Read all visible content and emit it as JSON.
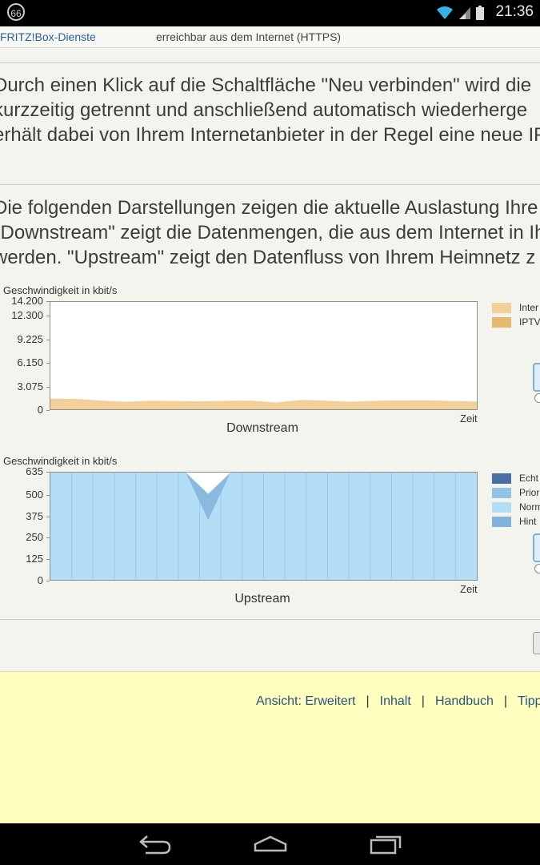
{
  "statusbar": {
    "badge": "66",
    "time": "21:36"
  },
  "toprow": {
    "service": "FRITZ!Box-Dienste",
    "access": "erreichbar aus dem Internet (HTTPS)"
  },
  "paragraph1": [
    "Durch einen Klick auf die Schaltfläche \"Neu verbinden\" wird die",
    "kurzzeitig getrennt und anschließend automatisch wiederherge",
    "erhält dabei von Ihrem Internetanbieter in der Regel eine neue IP"
  ],
  "paragraph2": [
    "Die folgenden Darstellungen zeigen die aktuelle Auslastung Ihre",
    "\"Downstream\" zeigt die Datenmengen, die aus dem Internet in Ih",
    "werden. \"Upstream\" zeigt den Datenfluss von Ihrem Heimnetz z"
  ],
  "chart_data": [
    {
      "type": "area",
      "title": "Downstream",
      "ylabel": "Geschwindigkeit in kbit/s",
      "xlabel": "Zeit",
      "yticks": [
        "0",
        "3.075",
        "6.150",
        "9.225",
        "12.300",
        "14.200"
      ],
      "ylim": [
        0,
        14200
      ],
      "grid": false,
      "legend_position": "right",
      "series": [
        {
          "name": "Inter",
          "color": "#f3cf9a",
          "values": [
            1400,
            1380,
            1150,
            1000,
            1120,
            1100,
            1050,
            1120,
            1130,
            900,
            1250,
            1120,
            1000,
            1120,
            1180,
            1200,
            1100,
            1020
          ]
        },
        {
          "name": "IPTV",
          "color": "#e4b970",
          "values": [
            0,
            0,
            0,
            0,
            0,
            0,
            0,
            0,
            0,
            0,
            0,
            0,
            0,
            0,
            0,
            0,
            0,
            0
          ]
        }
      ]
    },
    {
      "type": "area",
      "title": "Upstream",
      "ylabel": "Geschwindigkeit in kbit/s",
      "xlabel": "Zeit",
      "yticks": [
        "0",
        "125",
        "250",
        "375",
        "500",
        "635"
      ],
      "ylim": [
        0,
        635
      ],
      "grid": false,
      "legend_position": "right",
      "series": [
        {
          "name": "Echt",
          "color": "#4a6fa5",
          "values": []
        },
        {
          "name": "Prior",
          "color": "#94c3e6",
          "values": []
        },
        {
          "name": "Norm",
          "color": "#b3def6",
          "values": [
            635,
            635,
            635,
            635,
            635,
            635,
            635,
            635,
            635,
            635,
            635,
            635,
            635,
            635,
            635,
            635,
            635,
            635,
            635,
            635
          ]
        },
        {
          "name": "Hint",
          "color": "#7fb3de",
          "values": []
        }
      ],
      "dip": {
        "color": "#8ab9e0",
        "min_value": 355
      }
    }
  ],
  "footer": {
    "links": [
      "Ansicht: Erweitert",
      "Inhalt",
      "Handbuch",
      "Tipp"
    ]
  }
}
